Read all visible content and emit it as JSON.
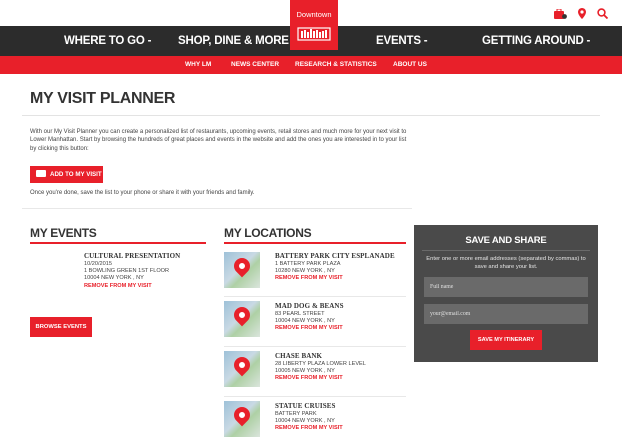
{
  "header": {
    "logo_text": "Downtown",
    "logo_mark": "AllianCe",
    "utility_icons": [
      "itinerary-bag-icon",
      "map-pin-icon",
      "search-icon"
    ],
    "main_nav": [
      "WHERE TO GO -",
      "SHOP, DINE & MORE -",
      "EVENTS -",
      "GETTING AROUND -"
    ],
    "sub_nav": [
      "WHY LM",
      "NEWS CENTER",
      "RESEARCH & STATISTICS",
      "ABOUT US"
    ]
  },
  "colors": {
    "accent": "#e8202a",
    "nav_dark": "#2c2c2c",
    "panel": "#4a4a4a"
  },
  "page": {
    "title": "MY VISIT PLANNER",
    "intro": "With our My Visit Planner you can create a personalized list of restaurants, upcoming events, retail stores and much more for your next visit to Lower Manhattan. Start by browsing the hundreds of great places and events in the website and add the ones you are interested in to your list by clicking this button:",
    "add_button": "ADD TO MY VISIT",
    "after_text": "Once you're done, save the list to your phone or share it with your friends and family."
  },
  "events": {
    "heading": "MY EVENTS",
    "items": [
      {
        "name": "CULTURAL PRESENTATION",
        "date": "10/20/2015",
        "address": "1 BOWLING GREEN 1ST FLOOR",
        "city": "10004 NEW YORK , NY",
        "remove": "REMOVE FROM MY VISIT"
      }
    ],
    "browse_button": "BROWSE EVENTS"
  },
  "locations": {
    "heading": "MY LOCATIONS",
    "items": [
      {
        "name": "BATTERY PARK CITY ESPLANADE",
        "address": "1 BATTERY PARK PLAZA",
        "city": "10280 NEW YORK , NY",
        "remove": "REMOVE FROM MY VISIT"
      },
      {
        "name": "MAD DOG & BEANS",
        "address": "83 PEARL STREET",
        "city": "10004 NEW YORK , NY",
        "remove": "REMOVE FROM MY VISIT"
      },
      {
        "name": "CHASE BANK",
        "address": "28 LIBERTY PLAZA LOWER LEVEL",
        "city": "10005 NEW YORK , NY",
        "remove": "REMOVE FROM MY VISIT"
      },
      {
        "name": "STATUE CRUISES",
        "address": "BATTERY PARK",
        "city": "10004 NEW YORK , NY",
        "remove": "REMOVE FROM MY VISIT"
      }
    ]
  },
  "save": {
    "heading": "SAVE AND SHARE",
    "text": "Enter one or more email addresses (separated by commas) to save and share your list.",
    "name_placeholder": "Full name",
    "email_placeholder": "your@email.com",
    "button": "SAVE MY ITINERARY"
  }
}
